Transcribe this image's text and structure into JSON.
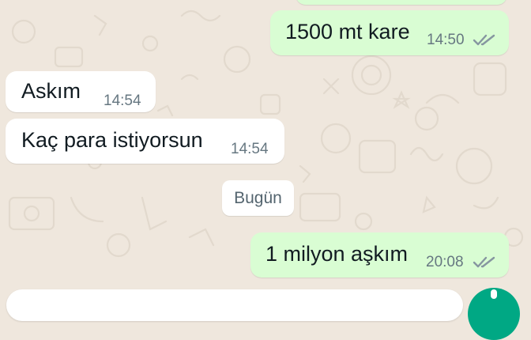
{
  "messages": [
    {
      "direction": "outgoing",
      "text": "1500 mt kare",
      "time": "14:50",
      "status": "read"
    },
    {
      "direction": "incoming",
      "text": "Askım",
      "time": "14:54"
    },
    {
      "direction": "incoming",
      "text": "Kaç para istiyorsun",
      "time": "14:54"
    },
    {
      "direction": "outgoing",
      "text": "1 milyon aşkım",
      "time": "20:08",
      "status": "read"
    }
  ],
  "date_separator": "Bugün",
  "colors": {
    "chat_background": "#efe7dd",
    "outgoing_bubble": "#d9fdd3",
    "incoming_bubble": "#ffffff",
    "read_ticks": "#8696a0",
    "accent": "#00a884"
  },
  "icons": {
    "read_receipt": "double-check-icon",
    "send": "mic-icon"
  }
}
